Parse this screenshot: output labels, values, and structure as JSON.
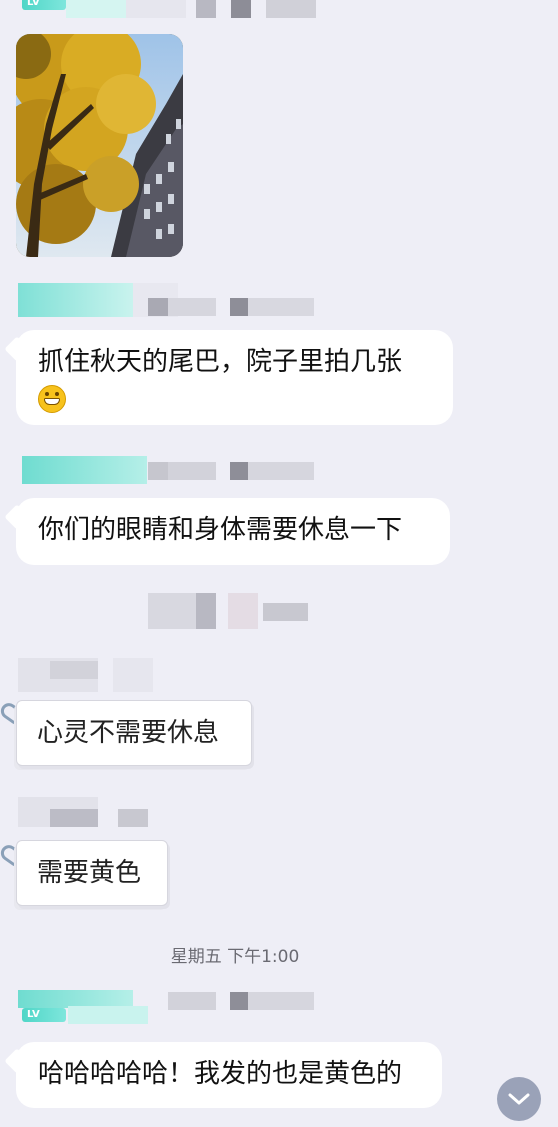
{
  "messages": [
    {
      "id": "m1",
      "type": "image",
      "alt_icon": "autumn-tree-photo"
    },
    {
      "id": "m2",
      "type": "text",
      "text_line1": "抓住秋天的尾巴，院子里拍几张",
      "emoji": "grinning-face-icon"
    },
    {
      "id": "m3",
      "type": "text",
      "text": "你们的眼睛和身体需要休息一下"
    },
    {
      "id": "m4",
      "type": "note",
      "text": "心灵不需要休息"
    },
    {
      "id": "m5",
      "type": "note",
      "text": "需要黄色"
    },
    {
      "id": "m6",
      "type": "text",
      "text": "哈哈哈哈哈！我发的也是黄色的"
    }
  ],
  "timestamp": "星期五 下午1:00",
  "badge_text": "LV",
  "colors": {
    "background": "#eeeef6",
    "bubble": "#ffffff",
    "badge": "#4fd6c7",
    "scroll_button": "#9aa2b8"
  },
  "scroll_button_icon": "chevron-down-icon"
}
